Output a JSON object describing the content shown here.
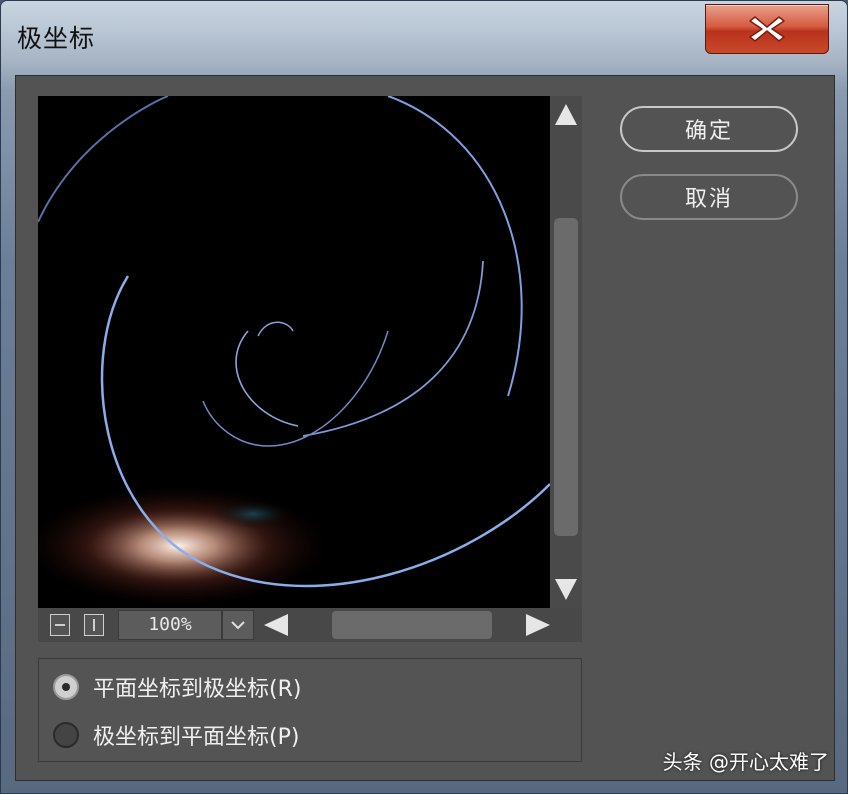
{
  "window": {
    "title": "极坐标",
    "close_icon": "close-icon"
  },
  "preview": {
    "zoom": "100%"
  },
  "buttons": {
    "ok": "确定",
    "cancel": "取消"
  },
  "options": [
    {
      "label": "平面坐标到极坐标(R)",
      "checked": true
    },
    {
      "label": "极坐标到平面坐标(P)",
      "checked": false
    }
  ],
  "watermark": "头条 @开心太难了",
  "colors": {
    "panel": "#535353",
    "preview_bg": "#000000",
    "close_red": "#c9482a",
    "arc_blue": "#7f9cd8",
    "glow": "#f4c4b0"
  }
}
